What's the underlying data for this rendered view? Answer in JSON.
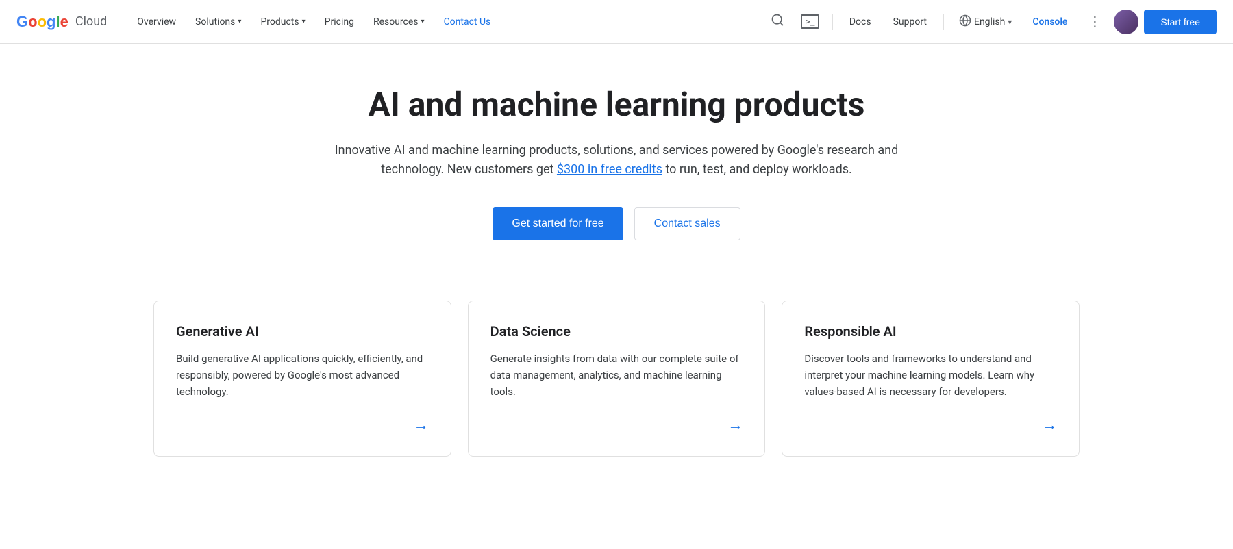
{
  "navbar": {
    "logo": {
      "google": "Google",
      "cloud": "Cloud"
    },
    "nav_items": [
      {
        "label": "Overview",
        "id": "overview"
      },
      {
        "label": "Solutions",
        "id": "solutions"
      },
      {
        "label": "Products",
        "id": "products"
      },
      {
        "label": "Pricing",
        "id": "pricing"
      },
      {
        "label": "Resources",
        "id": "resources"
      },
      {
        "label": "Contact Us",
        "id": "contact",
        "active": true
      }
    ],
    "right": {
      "docs": "Docs",
      "support": "Support",
      "language": "English",
      "console": "Console",
      "start_free": "Start free"
    }
  },
  "hero": {
    "title": "AI and machine learning products",
    "subtitle_before": "Innovative AI and machine learning products, solutions, and services powered by Google's research and technology. New customers get ",
    "credits_link": "$300 in free credits",
    "subtitle_after": " to run, test, and deploy workloads.",
    "btn_primary": "Get started for free",
    "btn_secondary": "Contact sales"
  },
  "cards": [
    {
      "id": "generative-ai",
      "title": "Generative AI",
      "description": "Build generative AI applications quickly, efficiently, and responsibly, powered by Google's most advanced technology.",
      "arrow": "→"
    },
    {
      "id": "data-science",
      "title": "Data Science",
      "description": "Generate insights from data with our complete suite of data management, analytics, and machine learning tools.",
      "arrow": "→"
    },
    {
      "id": "responsible-ai",
      "title": "Responsible AI",
      "description": "Discover tools and frameworks to understand and interpret your machine learning models. Learn why values-based AI is necessary for developers.",
      "arrow": "→"
    }
  ],
  "icons": {
    "search": "🔍",
    "terminal": ">_",
    "globe": "🌐",
    "chevron_down": "▾",
    "more_vert": "⋮"
  },
  "colors": {
    "primary_blue": "#1a73e8",
    "text_dark": "#202124",
    "text_medium": "#3c4043",
    "text_light": "#5f6368",
    "border": "#e0e0e0",
    "bg_white": "#ffffff"
  }
}
